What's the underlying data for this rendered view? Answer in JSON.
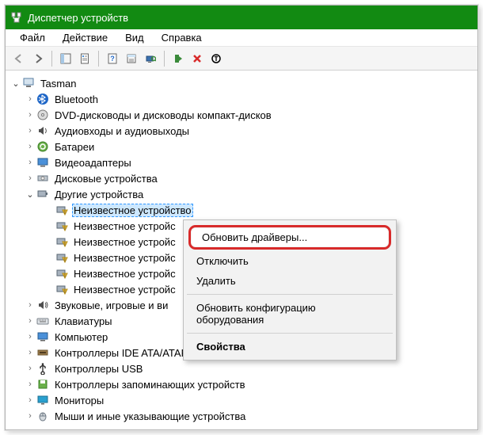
{
  "title": "Диспетчер устройств",
  "menu": [
    "Файл",
    "Действие",
    "Вид",
    "Справка"
  ],
  "root": "Tasman",
  "categories": [
    {
      "label": "Bluetooth",
      "icon": "bluetooth"
    },
    {
      "label": "DVD-дисководы и дисководы компакт-дисков",
      "icon": "dvd"
    },
    {
      "label": "Аудиовходы и аудиовыходы",
      "icon": "audio"
    },
    {
      "label": "Батареи",
      "icon": "battery"
    },
    {
      "label": "Видеоадаптеры",
      "icon": "display"
    },
    {
      "label": "Дисковые устройства",
      "icon": "disk"
    },
    {
      "label": "Другие устройства",
      "icon": "other",
      "open": true
    },
    {
      "label": "Звуковые, игровые и ви",
      "icon": "sound"
    },
    {
      "label": "Клавиатуры",
      "icon": "keyboard"
    },
    {
      "label": "Компьютер",
      "icon": "computer"
    },
    {
      "label": "Контроллеры IDE ATA/ATAPI",
      "icon": "ide"
    },
    {
      "label": "Контроллеры USB",
      "icon": "usb"
    },
    {
      "label": "Контроллеры запоминающих устройств",
      "icon": "storage"
    },
    {
      "label": "Мониторы",
      "icon": "monitor"
    },
    {
      "label": "Мыши и иные указывающие устройства",
      "icon": "mouse"
    }
  ],
  "unknown_items": [
    "Неизвестное устройство",
    "Неизвестное устройс",
    "Неизвестное устройс",
    "Неизвестное устройс",
    "Неизвестное устройс",
    "Неизвестное устройс"
  ],
  "ctx": {
    "update": "Обновить драйверы...",
    "disable": "Отключить",
    "remove": "Удалить",
    "rescan": "Обновить конфигурацию оборудования",
    "props": "Свойства"
  }
}
